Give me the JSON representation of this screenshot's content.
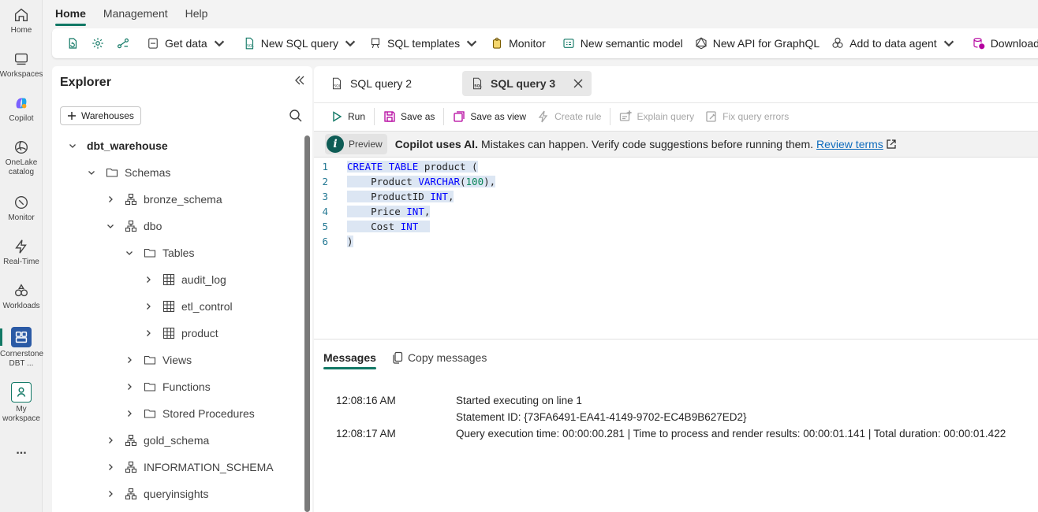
{
  "rail": {
    "items": [
      {
        "label": "Home"
      },
      {
        "label": "Workspaces"
      },
      {
        "label": "Copilot"
      },
      {
        "label": "OneLake catalog"
      },
      {
        "label": "Monitor"
      },
      {
        "label": "Real-Time"
      },
      {
        "label": "Workloads"
      },
      {
        "label": "Cornerstone DBT ..."
      },
      {
        "label": "My workspace"
      }
    ],
    "more": "..."
  },
  "ribbon": {
    "tabs": [
      "Home",
      "Management",
      "Help"
    ],
    "buttons": {
      "get_data": "Get data",
      "new_sql_query": "New SQL query",
      "sql_templates": "SQL templates",
      "monitor": "Monitor",
      "new_semantic_model": "New semantic model",
      "new_api_graphql": "New API for GraphQL",
      "add_to_data_agent": "Add to data agent",
      "download_sql": "Download SQL da"
    }
  },
  "explorer": {
    "title": "Explorer",
    "warehouses_button": "Warehouses",
    "tree": {
      "warehouse": "dbt_warehouse",
      "schemas": "Schemas",
      "bronze": "bronze_schema",
      "dbo": "dbo",
      "tables": "Tables",
      "audit_log": "audit_log",
      "etl_control": "etl_control",
      "product": "product",
      "views": "Views",
      "functions": "Functions",
      "stored_procedures": "Stored Procedures",
      "gold": "gold_schema",
      "information_schema": "INFORMATION_SCHEMA",
      "queryinsights": "queryinsights"
    }
  },
  "editor": {
    "tabs": {
      "q2": "SQL query 2",
      "q3": "SQL query 3"
    },
    "toolbar": {
      "run": "Run",
      "save_as": "Save as",
      "save_as_view": "Save as view",
      "create_rule": "Create rule",
      "explain_query": "Explain query",
      "fix_query_errors": "Fix query errors"
    },
    "banner": {
      "preview": "Preview",
      "bold": "Copilot uses AI.",
      "text": "Mistakes can happen. Verify code suggestions before running them.",
      "link": "Review terms"
    },
    "line_numbers": [
      "1",
      "2",
      "3",
      "4",
      "5",
      "6"
    ],
    "code_lines": [
      "CREATE TABLE product (",
      "    Product VARCHAR(100),",
      "    ProductID INT,",
      "    Price INT,",
      "    Cost INT",
      ")"
    ]
  },
  "messages": {
    "tab": "Messages",
    "copy": "Copy messages",
    "rows": [
      {
        "time": "12:08:16 AM",
        "text": "Started executing on line 1"
      },
      {
        "time": "",
        "text": "Statement ID: {73FA6491-EA41-4149-9702-EC4B9B627ED2}"
      },
      {
        "time": "12:08:17 AM",
        "text": "Query execution time: 00:00:00.281 | Time to process and render results: 00:00:01.141 | Total duration: 00:00:01.422"
      }
    ]
  }
}
